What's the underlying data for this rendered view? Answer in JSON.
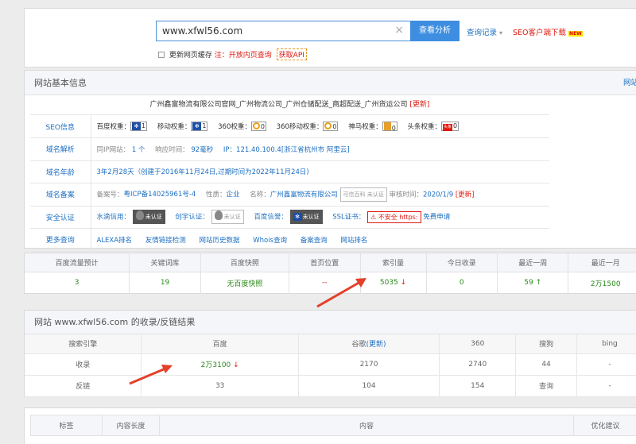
{
  "search": {
    "query": "www.xfwl56.com",
    "clear": "×",
    "button": "查看分析",
    "history": "查询记录",
    "history_caret": "▾",
    "seo_download": "SEO客户端下载",
    "new_badge": "NEW",
    "refresh_cache": "更新网页缓存",
    "note": "注：开放内页查询",
    "api": "获取API"
  },
  "basic": {
    "title": "网站基本信息",
    "right_link": "网站SE",
    "company": "广州鑫富物流有限公司官网_广州物流公司_广州仓储配送_商超配送_广州货运公司",
    "update": "[更新]",
    "seo": {
      "label": "SEO信息",
      "items": [
        {
          "name": "百度权重：",
          "value": "1"
        },
        {
          "name": "移动权重：",
          "value": "1"
        },
        {
          "name": "360权重：",
          "value": "0"
        },
        {
          "name": "360移动权重：",
          "value": "0"
        },
        {
          "name": "神马权重：",
          "value": "0"
        },
        {
          "name": "头条权重：",
          "value": "0"
        }
      ],
      "toutiao_icon": "头条"
    },
    "domain": {
      "label": "域名解析",
      "ip_sites_label": "同IP网站：",
      "ip_sites": "1 个",
      "resp_label": "响应时间：",
      "resp": "92毫秒",
      "ip": "IP：121.40.100.4",
      "location": "[浙江省杭州市 阿里云]"
    },
    "age": {
      "label": "域名年龄",
      "value": "3年2月28天（创建于2016年11月24日,过期时间为2022年11月24日)"
    },
    "icp": {
      "label": "域名备案",
      "no_label": "备案号：",
      "no": "粤ICP备14025961号-4",
      "nature_label": "性质：",
      "nature": "企业",
      "name_label": "名称：",
      "name": "广州鑫富物流有限公司",
      "cert": "可信百科 未认证",
      "audit_label": "审核时间：",
      "audit": "2020/1/9",
      "update": "[更新]"
    },
    "security": {
      "label": "安全认证",
      "shuidi": "水滴信用：",
      "shuidi_badge": "未认证",
      "chuangyu": "创宇认证：",
      "chuangyu_badge": "未认证",
      "baidu": "百度信誉：",
      "baidu_badge": "未认证",
      "ssl": "SSL证书：",
      "ssl_badge": "⚠ 不安全 https:",
      "free": "免费申请"
    },
    "more": {
      "label": "更多查询",
      "links": [
        "ALEXA排名",
        "友情链接检测",
        "网站历史数据",
        "Whois查询",
        "备案查询",
        "网站排名"
      ]
    }
  },
  "stats": {
    "headers": [
      "百度流量预计",
      "关键词库",
      "百度快照",
      "首页位置",
      "索引量",
      "今日收录",
      "最近一周",
      "最近一月"
    ],
    "values": [
      "3",
      "19",
      "无百度快照",
      "--",
      "5035",
      "0",
      "59",
      "2万1500"
    ],
    "down": "↓",
    "up": "↑"
  },
  "index": {
    "title": "网站 www.xfwl56.com 的收录/反链结果",
    "headers": [
      "搜索引擎",
      "百度",
      "谷歌",
      "(更新)",
      "360",
      "搜狗",
      "bing"
    ],
    "rows": [
      {
        "label": "收录",
        "baidu": "2万3100",
        "google": "2170",
        "s360": "2740",
        "sogou": "44",
        "bing": "-"
      },
      {
        "label": "反链",
        "baidu": "33",
        "google": "104",
        "s360": "154",
        "sogou": "查询",
        "bing": "-"
      }
    ]
  },
  "bottom": {
    "headers": [
      "标签",
      "内容长度",
      "内容",
      "优化建议"
    ]
  },
  "colors": {
    "accent": "#3d8ee0",
    "link": "#1d6fc2",
    "alert": "#e0190f",
    "good": "#2b8a1a",
    "arrow": "#e4402a"
  }
}
